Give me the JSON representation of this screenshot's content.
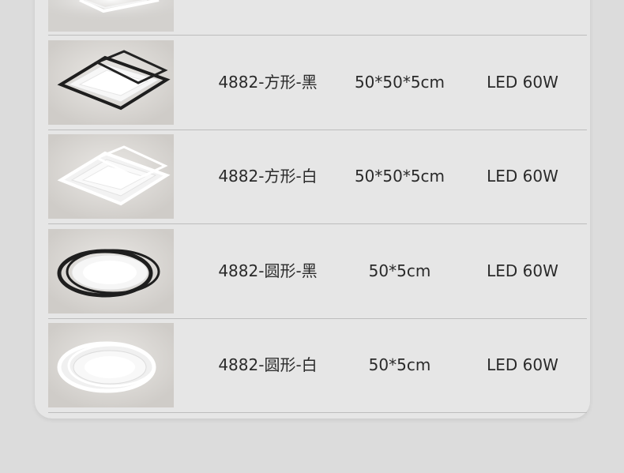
{
  "rows": [
    {
      "model": "4882-方形-黑",
      "size": "50*50*5cm",
      "power": "LED 60W",
      "icon": "square-black-lamp-icon"
    },
    {
      "model": "4882-方形-白",
      "size": "50*50*5cm",
      "power": "LED 60W",
      "icon": "square-white-lamp-icon"
    },
    {
      "model": "4882-圆形-黑",
      "size": "50*5cm",
      "power": "LED 60W",
      "icon": "round-black-lamp-icon"
    },
    {
      "model": "4882-圆形-白",
      "size": "50*5cm",
      "power": "LED 60W",
      "icon": "round-white-lamp-icon"
    }
  ],
  "colors": {
    "background": "#dcdcdc",
    "card": "#e6e6e6",
    "divider": "#bdbdbd",
    "text": "#2a2a2a"
  }
}
